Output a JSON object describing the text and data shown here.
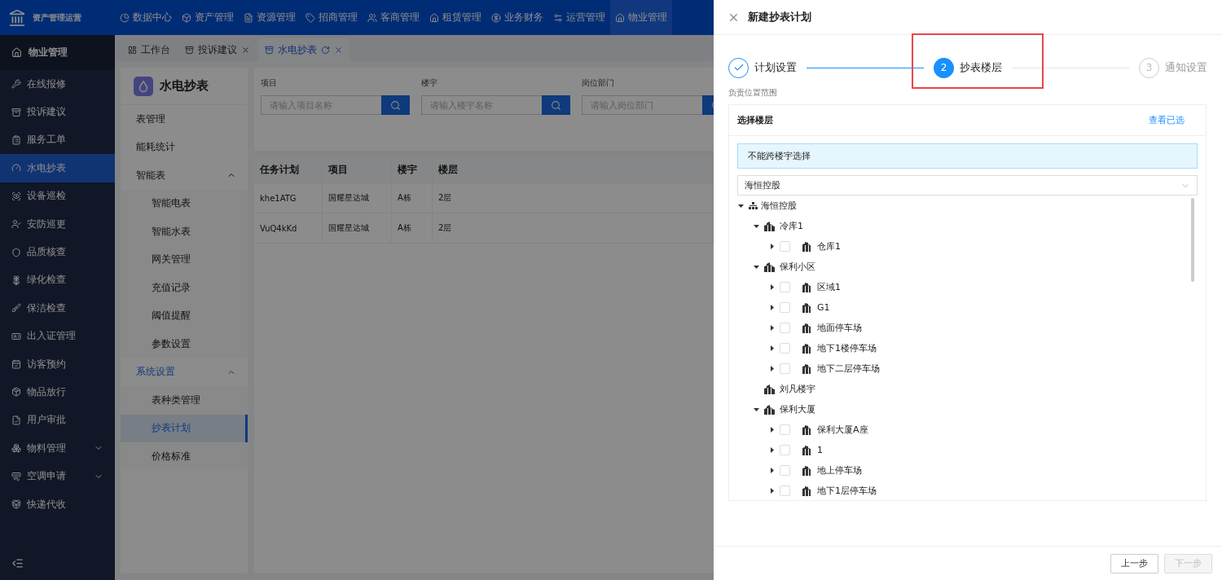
{
  "app": {
    "title": "资产管理运营"
  },
  "top_nav": [
    {
      "label": "数据中心",
      "selected": false
    },
    {
      "label": "资产管理",
      "selected": false
    },
    {
      "label": "资源管理",
      "selected": false
    },
    {
      "label": "招商管理",
      "selected": false
    },
    {
      "label": "客商管理",
      "selected": false
    },
    {
      "label": "租赁管理",
      "selected": false
    },
    {
      "label": "业务财务",
      "selected": false
    },
    {
      "label": "运营管理",
      "selected": false
    },
    {
      "label": "物业管理",
      "selected": true
    }
  ],
  "sidebar": {
    "header": "物业管理",
    "items": [
      {
        "label": "在线报修",
        "selected": false,
        "has_submenu": false
      },
      {
        "label": "投诉建议",
        "selected": false,
        "has_submenu": false
      },
      {
        "label": "服务工单",
        "selected": false,
        "has_submenu": false
      },
      {
        "label": "水电抄表",
        "selected": true,
        "has_submenu": false
      },
      {
        "label": "设备巡检",
        "selected": false,
        "has_submenu": false
      },
      {
        "label": "安防巡更",
        "selected": false,
        "has_submenu": false
      },
      {
        "label": "品质核查",
        "selected": false,
        "has_submenu": false
      },
      {
        "label": "绿化检查",
        "selected": false,
        "has_submenu": false
      },
      {
        "label": "保洁检查",
        "selected": false,
        "has_submenu": false
      },
      {
        "label": "出入证管理",
        "selected": false,
        "has_submenu": false
      },
      {
        "label": "访客预约",
        "selected": false,
        "has_submenu": false
      },
      {
        "label": "物品放行",
        "selected": false,
        "has_submenu": false
      },
      {
        "label": "用户审批",
        "selected": false,
        "has_submenu": false
      },
      {
        "label": "物料管理",
        "selected": false,
        "has_submenu": true
      },
      {
        "label": "空调申请",
        "selected": false,
        "has_submenu": true
      },
      {
        "label": "快递代收",
        "selected": false,
        "has_submenu": false
      }
    ]
  },
  "tabs": [
    {
      "label": "工作台",
      "selected": false,
      "closable": false,
      "refreshable": false
    },
    {
      "label": "投诉建议",
      "selected": false,
      "closable": true,
      "refreshable": false
    },
    {
      "label": "水电抄表",
      "selected": true,
      "closable": true,
      "refreshable": true
    }
  ],
  "submenu": {
    "title": "水电抄表",
    "items": [
      {
        "label": "表管理",
        "selected": false
      },
      {
        "label": "能耗统计",
        "selected": false
      },
      {
        "label": "智能表",
        "selected": false,
        "expanded": true,
        "children": [
          {
            "label": "智能电表",
            "selected": false
          },
          {
            "label": "智能水表",
            "selected": false
          },
          {
            "label": "网关管理",
            "selected": false
          },
          {
            "label": "充值记录",
            "selected": false
          },
          {
            "label": "阈值提醒",
            "selected": false
          },
          {
            "label": "参数设置",
            "selected": false
          }
        ]
      },
      {
        "label": "系统设置",
        "selected": true,
        "expanded": true,
        "children": [
          {
            "label": "表种类管理",
            "selected": false
          },
          {
            "label": "抄表计划",
            "selected": true
          },
          {
            "label": "价格标准",
            "selected": false
          }
        ]
      }
    ]
  },
  "filters": [
    {
      "label": "项目",
      "placeholder": "请输入项目名称"
    },
    {
      "label": "楼宇",
      "placeholder": "请输入楼宇名称"
    },
    {
      "label": "岗位部门",
      "placeholder": "请输入岗位部门"
    }
  ],
  "table": {
    "columns": [
      "任务计划",
      "项目",
      "楼宇",
      "楼层"
    ],
    "rows": [
      [
        "khe1ATG",
        "国耀星达城",
        "A栋",
        "2层"
      ],
      [
        "VuQ4kKd",
        "国耀星达城",
        "A栋",
        "2层"
      ]
    ]
  },
  "drawer": {
    "title": "新建抄表计划",
    "steps": [
      {
        "label": "计划设置",
        "done": true,
        "selected": false
      },
      {
        "number": "2",
        "label": "抄表楼层",
        "done": false,
        "selected": true
      },
      {
        "number": "3",
        "label": "通知设置",
        "done": false,
        "selected": false
      }
    ],
    "section_label": "负责位置范围",
    "card_title": "选择楼层",
    "card_link": "查看已选",
    "notice": "不能跨楼宇选择",
    "select_value": "海恒控股",
    "tree": [
      {
        "label": "海恒控股",
        "kind": "org",
        "expanded": true,
        "children": [
          {
            "label": "冷库1",
            "kind": "site",
            "expanded": true,
            "children": [
              {
                "label": "仓库1",
                "kind": "building",
                "expanded": false,
                "checked": false
              }
            ]
          },
          {
            "label": "保利小区",
            "kind": "site",
            "expanded": true,
            "children": [
              {
                "label": "区域1",
                "kind": "building",
                "expanded": false,
                "checked": false
              },
              {
                "label": "G1",
                "kind": "building",
                "expanded": false,
                "checked": false
              },
              {
                "label": "地面停车场",
                "kind": "building",
                "expanded": false,
                "checked": false
              },
              {
                "label": "地下1楼停车场",
                "kind": "building",
                "expanded": false,
                "checked": false
              },
              {
                "label": "地下二层停车场",
                "kind": "building",
                "expanded": false,
                "checked": false
              }
            ]
          },
          {
            "label": "刘凡楼宇",
            "kind": "site"
          },
          {
            "label": "保利大厦",
            "kind": "site",
            "expanded": true,
            "children": [
              {
                "label": "保利大厦A座",
                "kind": "building",
                "expanded": false,
                "checked": false
              },
              {
                "label": "1",
                "kind": "building",
                "expanded": false,
                "checked": false
              },
              {
                "label": "地上停车场",
                "kind": "building",
                "expanded": false,
                "checked": false
              },
              {
                "label": "地下1层停车场",
                "kind": "building",
                "expanded": false,
                "checked": false
              }
            ]
          }
        ]
      }
    ],
    "buttons": [
      {
        "label": "上一步",
        "disabled": false
      },
      {
        "label": "下一步",
        "disabled": true
      }
    ]
  }
}
